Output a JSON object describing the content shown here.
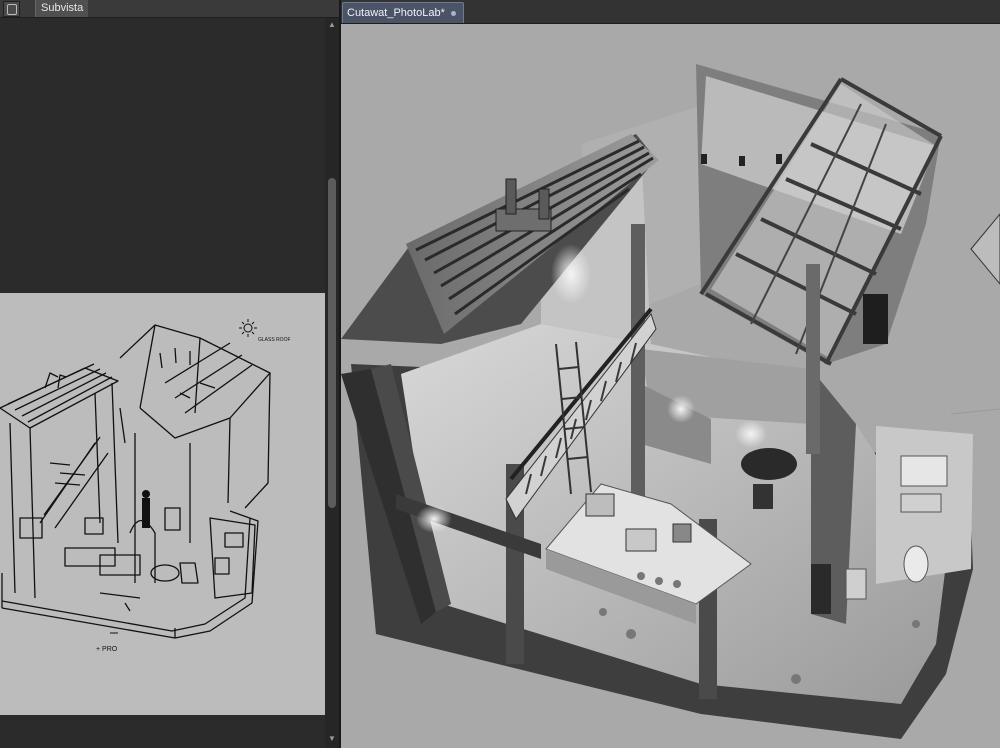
{
  "subview": {
    "panel_title": "Subvista",
    "panel_icon": "subview-panel-icon",
    "sketch_notes": {
      "glass_roof": "GLASS ROOF",
      "pro": "+ PRO"
    }
  },
  "document": {
    "tab_title": "Cutawat_PhotoLab*",
    "tab_modified_indicator": "dot-icon"
  },
  "colors": {
    "ui_dark": "#2b2b2b",
    "tab_active": "#4a5466",
    "canvas_gray": "#a9a9a9",
    "sketch_gray": "#bcbcbc"
  }
}
